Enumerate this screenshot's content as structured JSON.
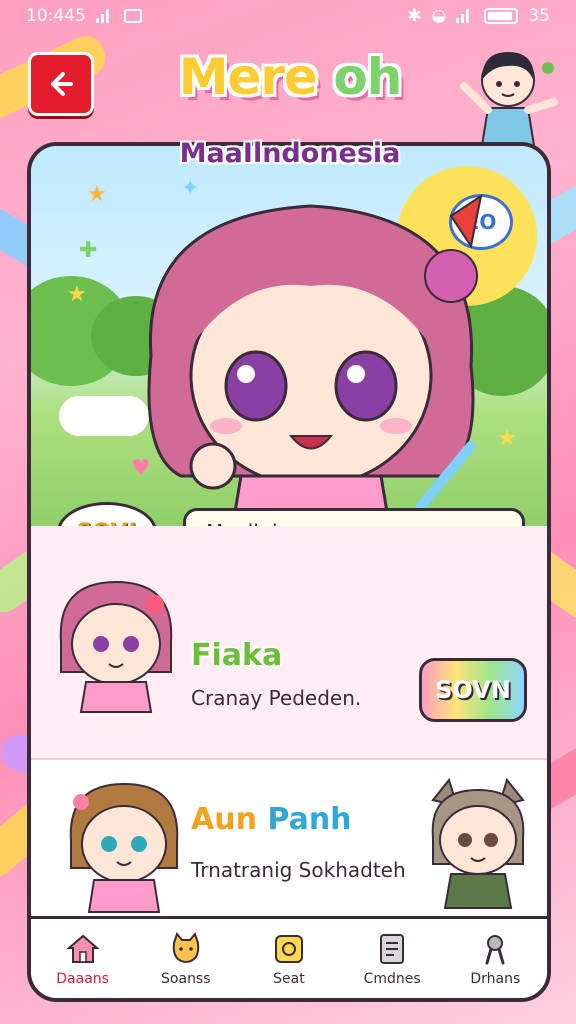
{
  "status_bar": {
    "time": "10:445",
    "battery_text": "35"
  },
  "header": {
    "title_part1": "Mere",
    "title_part2": "oh",
    "subtitle": "MaaIlndonesia"
  },
  "scene": {
    "sun_badge_text": "EO",
    "speech_badge": "SOV!",
    "name_field_value": "Maalkdans"
  },
  "characters": [
    {
      "name": "Fiaka",
      "description": "Cranay Pededen.",
      "action_label": "SOVN"
    },
    {
      "name_part1": "Aun",
      "name_part2": "Panh",
      "description": "Trnatranig Sokhadteh"
    }
  ],
  "nav": {
    "items": [
      {
        "label": "Daaans",
        "icon": "house-icon"
      },
      {
        "label": "Soanss",
        "icon": "cat-icon"
      },
      {
        "label": "Seat",
        "icon": "coin-icon"
      },
      {
        "label": "Cmdnes",
        "icon": "list-icon"
      },
      {
        "label": "Drhans",
        "icon": "wrench-icon"
      }
    ]
  },
  "colors": {
    "back_button": "#e31b2a",
    "card_border": "#3a2a3a",
    "active_nav": "#d0213a",
    "bg_pink": "#ffb3cf"
  }
}
